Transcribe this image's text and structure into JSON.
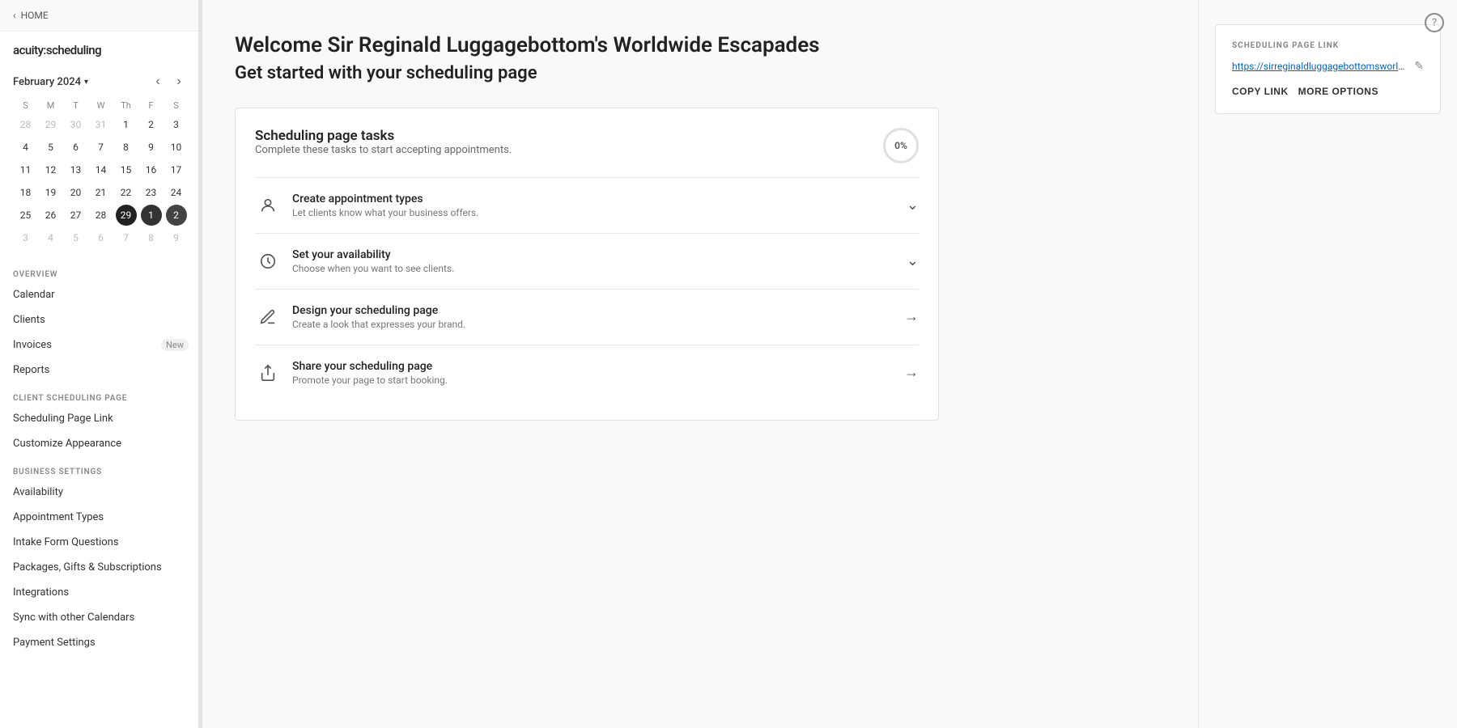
{
  "sidebar": {
    "back_label": "HOME",
    "logo": "acuity:scheduling",
    "calendar": {
      "month_label": "February 2024",
      "day_headers": [
        "S",
        "M",
        "T",
        "W",
        "Th",
        "F",
        "S"
      ],
      "weeks": [
        [
          "28",
          "29",
          "30",
          "31",
          "1",
          "2",
          "3"
        ],
        [
          "4",
          "5",
          "6",
          "7",
          "8",
          "9",
          "10"
        ],
        [
          "11",
          "12",
          "13",
          "14",
          "15",
          "16",
          "17"
        ],
        [
          "18",
          "19",
          "20",
          "21",
          "22",
          "23",
          "24"
        ],
        [
          "25",
          "26",
          "27",
          "28",
          "29",
          "1",
          "2"
        ],
        [
          "3",
          "4",
          "5",
          "6",
          "7",
          "8",
          "9"
        ]
      ],
      "week_other_flags": [
        [
          true,
          true,
          true,
          true,
          false,
          false,
          false
        ],
        [
          false,
          false,
          false,
          false,
          false,
          false,
          false
        ],
        [
          false,
          false,
          false,
          false,
          false,
          false,
          false
        ],
        [
          false,
          false,
          false,
          false,
          false,
          false,
          false
        ],
        [
          false,
          false,
          false,
          false,
          false,
          true,
          true
        ],
        [
          true,
          true,
          true,
          true,
          true,
          true,
          true
        ]
      ],
      "selected_day": "29",
      "today_days": [
        "1",
        "2"
      ]
    },
    "sections": {
      "overview": {
        "label": "OVERVIEW",
        "items": [
          {
            "label": "Calendar",
            "badge": ""
          },
          {
            "label": "Clients",
            "badge": ""
          },
          {
            "label": "Invoices",
            "badge": "New"
          },
          {
            "label": "Reports",
            "badge": ""
          }
        ]
      },
      "client_scheduling": {
        "label": "CLIENT SCHEDULING PAGE",
        "items": [
          {
            "label": "Scheduling Page Link",
            "badge": ""
          },
          {
            "label": "Customize Appearance",
            "badge": ""
          }
        ]
      },
      "business_settings": {
        "label": "BUSINESS SETTINGS",
        "items": [
          {
            "label": "Availability",
            "badge": ""
          },
          {
            "label": "Appointment Types",
            "badge": ""
          },
          {
            "label": "Intake Form Questions",
            "badge": ""
          },
          {
            "label": "Packages, Gifts & Subscriptions",
            "badge": ""
          },
          {
            "label": "Integrations",
            "badge": ""
          },
          {
            "label": "Sync with other Calendars",
            "badge": ""
          },
          {
            "label": "Payment Settings",
            "badge": ""
          }
        ]
      }
    }
  },
  "main": {
    "welcome_line1": "Welcome Sir Reginald Luggagebottom's Worldwide Escapades",
    "welcome_line2": "Get started with your scheduling page",
    "tasks_card": {
      "title": "Scheduling page tasks",
      "subtitle": "Complete these tasks to start accepting appointments.",
      "progress": "0%",
      "tasks": [
        {
          "id": "create-appointment-types",
          "icon": "person-icon",
          "title": "Create appointment types",
          "desc": "Let clients know what your business offers.",
          "action": "chevron-down"
        },
        {
          "id": "set-availability",
          "icon": "clock-icon",
          "title": "Set your availability",
          "desc": "Choose when you want to see clients.",
          "action": "chevron-down"
        },
        {
          "id": "design-scheduling-page",
          "icon": "pen-icon",
          "title": "Design your scheduling page",
          "desc": "Create a look that expresses your brand.",
          "action": "arrow-right"
        },
        {
          "id": "share-scheduling-page",
          "icon": "share-icon",
          "title": "Share your scheduling page",
          "desc": "Promote your page to start booking.",
          "action": "arrow-right"
        }
      ]
    }
  },
  "right_panel": {
    "scheduling_link": {
      "label": "SCHEDULING PAGE LINK",
      "url": "https://sirreginaldluggagebottomsworldwideescapad...",
      "copy_label": "COPY LINK",
      "more_options_label": "MORE OPTIONS"
    }
  },
  "help_icon": "?"
}
